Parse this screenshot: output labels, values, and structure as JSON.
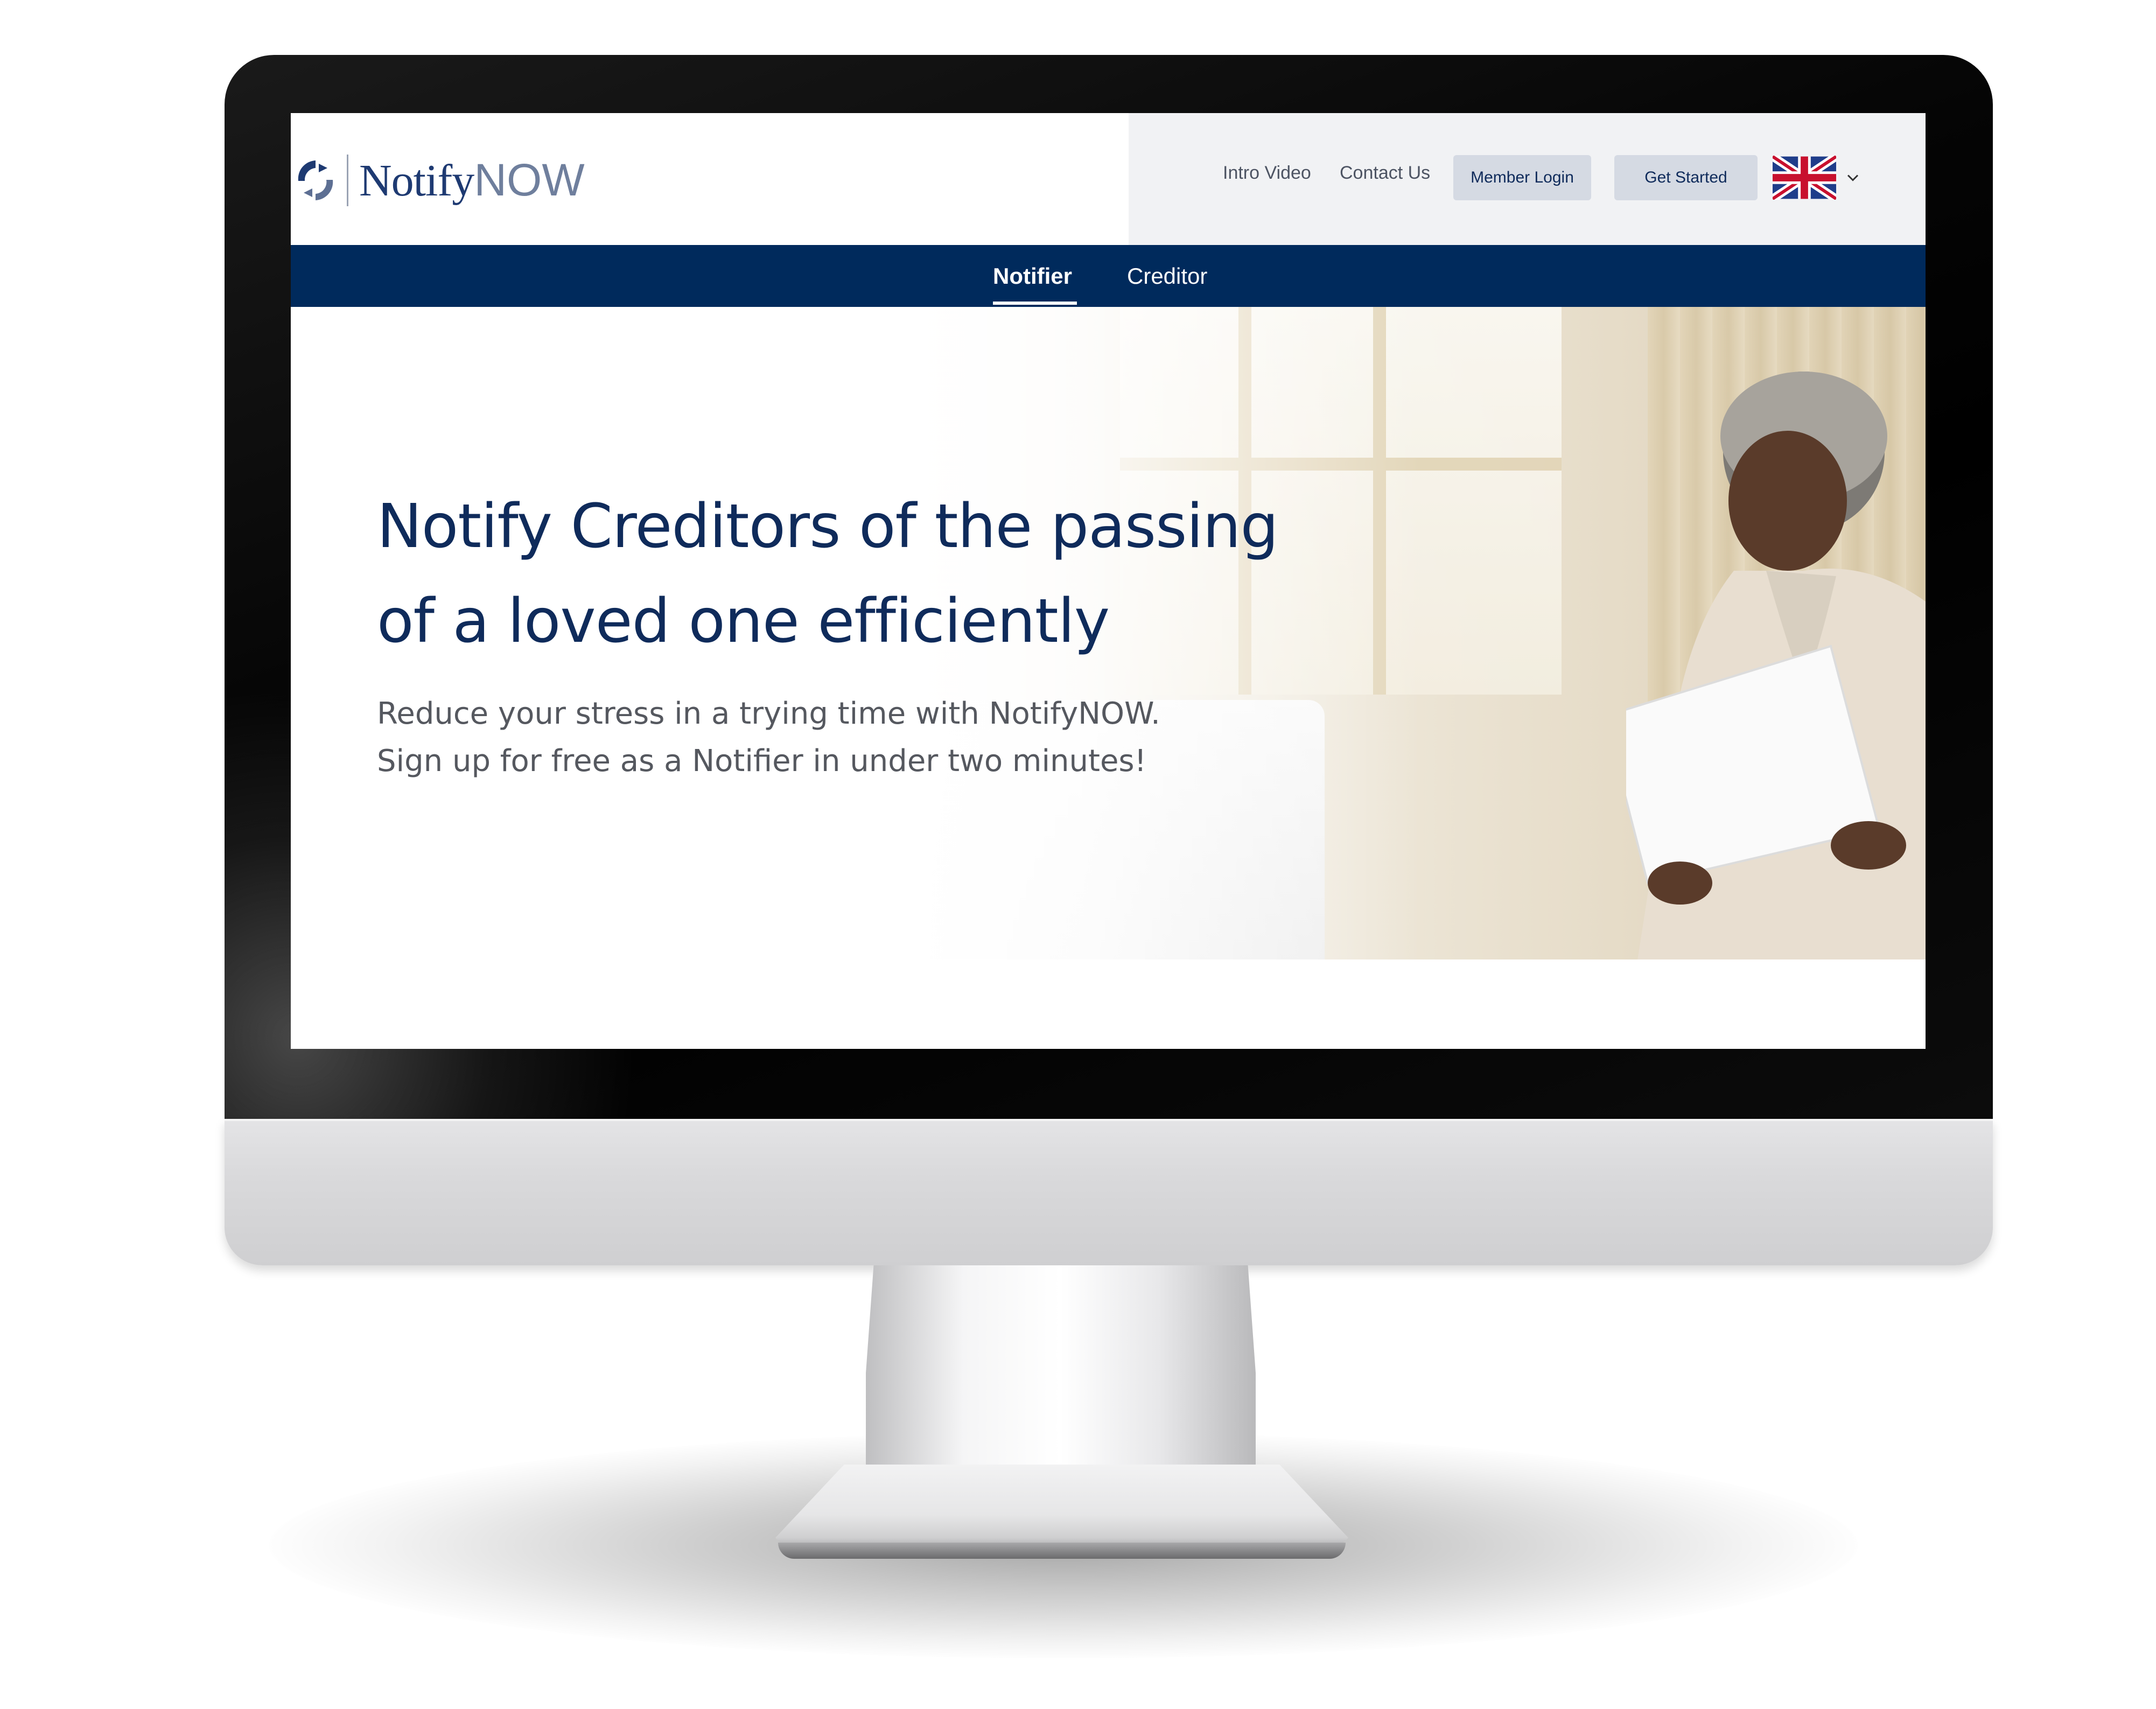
{
  "brand": {
    "name_primary": "Notify",
    "name_secondary": "NOW",
    "color_navy": "#002a5c",
    "color_button": "#d5dae3"
  },
  "header": {
    "nav_links": [
      "Intro Video",
      "Contact Us"
    ],
    "member_login_label": "Member Login",
    "get_started_label": "Get Started",
    "language": {
      "icon": "uk-flag-icon",
      "dropdown_icon": "chevron-down-icon"
    }
  },
  "tabs": [
    {
      "label": "Notifier",
      "active": true
    },
    {
      "label": "Creditor",
      "active": false
    }
  ],
  "hero": {
    "title": "Notify Creditors of the passing of a loved one efficiently",
    "subtitle_line1": "Reduce your stress in a trying time with NotifyNOW.",
    "subtitle_line2": "Sign up for free as a Notifier in under two minutes!"
  }
}
